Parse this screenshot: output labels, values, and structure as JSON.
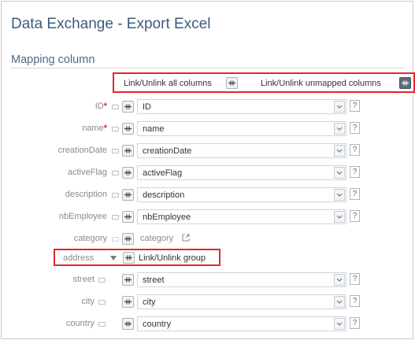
{
  "page": {
    "title": "Data Exchange - Export Excel",
    "section": "Mapping column"
  },
  "toolbar": {
    "link_all": "Link/Unlink all columns",
    "link_unmapped": "Link/Unlink unmapped columns"
  },
  "rows": [
    {
      "label": "ID",
      "required": "*",
      "value": "ID"
    },
    {
      "label": "name",
      "required": "*",
      "value": "name"
    },
    {
      "label": "creationDate",
      "value": "creationDate"
    },
    {
      "label": "activeFlag",
      "value": "activeFlag"
    },
    {
      "label": "description",
      "value": "description"
    },
    {
      "label": "nbEmployee",
      "value": "nbEmployee"
    }
  ],
  "category": {
    "label": "category",
    "value": "category"
  },
  "address": {
    "label": "address",
    "group_link": "Link/Unlink group"
  },
  "sub_rows": [
    {
      "label": "street",
      "value": "street"
    },
    {
      "label": "city",
      "value": "city"
    },
    {
      "label": "country",
      "value": "country"
    }
  ],
  "help": "?"
}
